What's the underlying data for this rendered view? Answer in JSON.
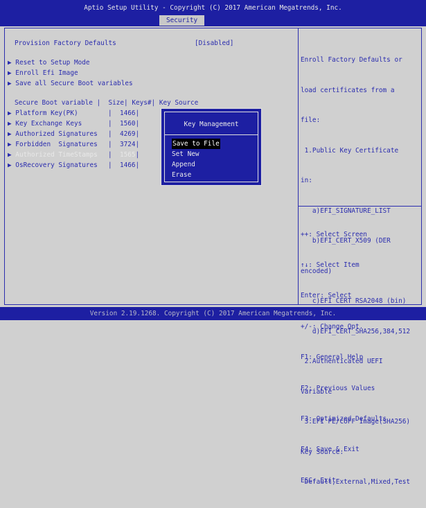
{
  "header": {
    "title": "Aptio Setup Utility - Copyright (C) 2017 American Megatrends, Inc.",
    "active_tab": "Security"
  },
  "main": {
    "provision": {
      "label": "Provision Factory Defaults",
      "value": "[Disabled]"
    },
    "actions": [
      {
        "label": "Reset to Setup Mode"
      },
      {
        "label": "Enroll Efi Image"
      },
      {
        "label": "Save all Secure Boot variables"
      }
    ],
    "table_header": "Secure Boot variable |  Size| Keys#| Key Source",
    "rows": [
      {
        "name": "Platform Key(PK)",
        "size": "1466"
      },
      {
        "name": "Key Exchange Keys",
        "size": "1560"
      },
      {
        "name": "Authorized Signatures",
        "size": "4269"
      },
      {
        "name": "Forbidden  Signatures",
        "size": "3724"
      },
      {
        "name": "Authorized TimeStamps",
        "size": "1565"
      },
      {
        "name": "OsRecovery Signatures",
        "size": "1466"
      }
    ]
  },
  "help_text": [
    "Enroll Factory Defaults or",
    "load certificates from a",
    "file:",
    " 1.Public Key Certificate",
    "in:",
    "   a)EFI_SIGNATURE_LIST",
    "   b)EFI_CERT_X509 (DER",
    "encoded)",
    "   c)EFI_CERT_RSA2048 (bin)",
    "   d)EFI_CERT_SHA256,384,512",
    " 2.Authenticated UEFI",
    "Variable",
    " 3.EFI PE/COFF Image(SHA256)",
    "Key Source:",
    " Default,External,Mixed,Test"
  ],
  "key_help": [
    "++: Select Screen",
    "↑↓: Select Item",
    "Enter: Select",
    "+/-: Change Opt.",
    "F1: General Help",
    "F2: Previous Values",
    "F3: Optimized Defaults",
    "F4: Save & Exit",
    "ESC: Exit"
  ],
  "dialog": {
    "title": "Key Management",
    "options": [
      "Save to File",
      "Set New",
      "Append",
      "Erase"
    ],
    "selected": "Save to File"
  },
  "footer": "Version 2.19.1268. Copyright (C) 2017 American Megatrends, Inc."
}
